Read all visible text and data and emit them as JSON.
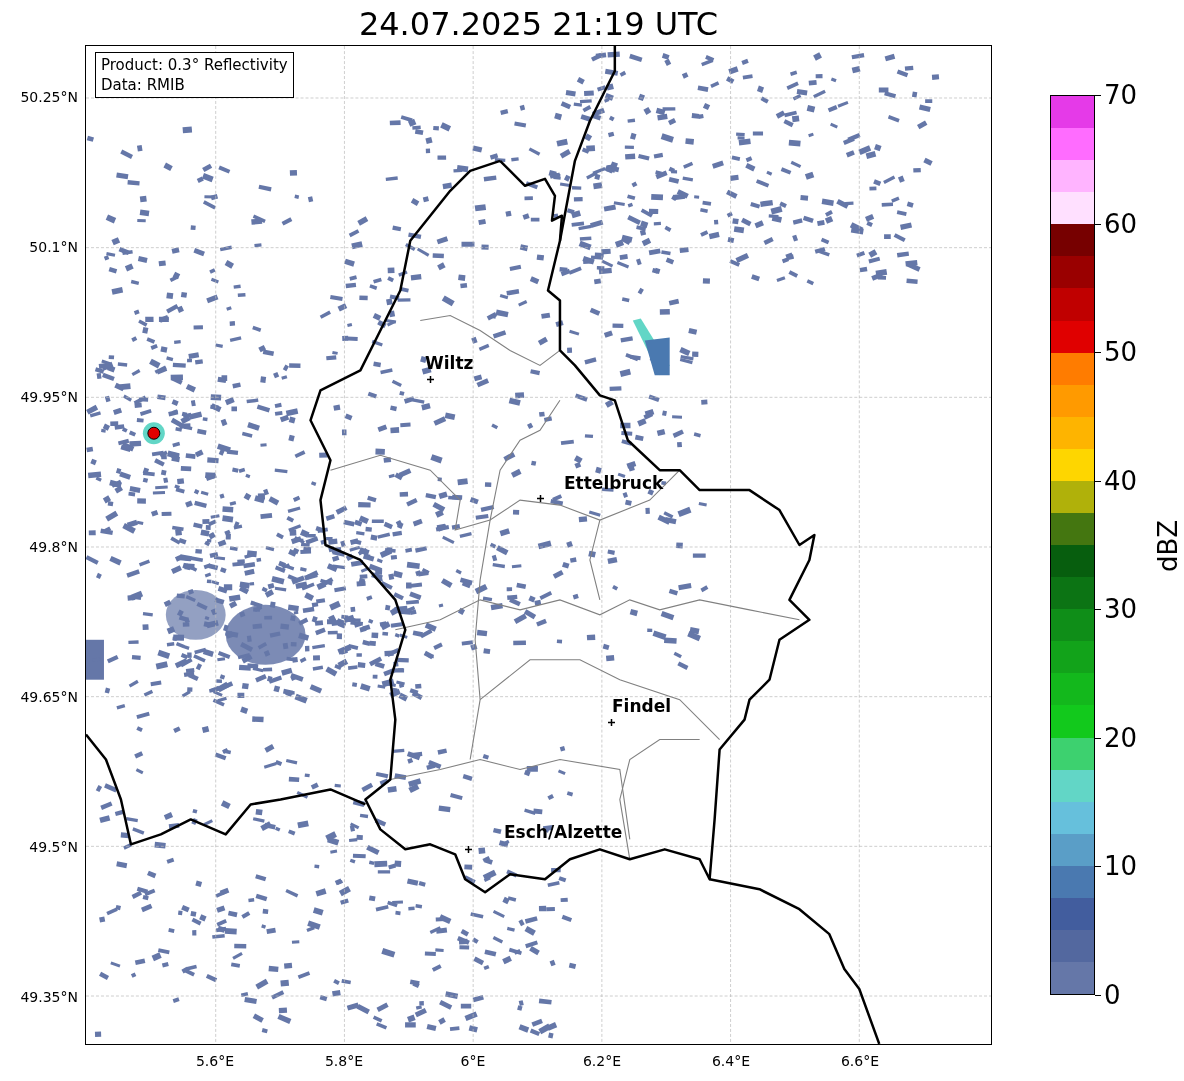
{
  "title": "24.07.2025 21:19 UTC",
  "legend": {
    "lines": [
      "Product: 0.3° Reflectivity",
      "Data: RMIB"
    ]
  },
  "map": {
    "kind": "map-picture"
  },
  "cities": [
    {
      "name": "Wiltz"
    },
    {
      "name": "Ettelbruck"
    },
    {
      "name": "Findel"
    },
    {
      "name": "Esch/Alzette"
    }
  ],
  "y_ticks": [
    "50.25°N",
    "50.1°N",
    "49.95°N",
    "49.8°N",
    "49.65°N",
    "49.5°N",
    "49.35°N"
  ],
  "x_ticks": [
    "5.6°E",
    "5.8°E",
    "6°E",
    "6.2°E",
    "6.4°E",
    "6.6°E"
  ],
  "colorbar": {
    "label": "dBZ",
    "ticks": [
      "70",
      "60",
      "50",
      "40",
      "30",
      "20",
      "10",
      "0"
    ],
    "segments": [
      {
        "color": "#e53ae8"
      },
      {
        "color": "#ff6cff"
      },
      {
        "color": "#ffb4ff"
      },
      {
        "color": "#ffe0ff"
      },
      {
        "color": "#770000"
      },
      {
        "color": "#9a0000"
      },
      {
        "color": "#c00000"
      },
      {
        "color": "#e00000"
      },
      {
        "color": "#ff7c00"
      },
      {
        "color": "#ff9a00"
      },
      {
        "color": "#feb400"
      },
      {
        "color": "#fed600"
      },
      {
        "color": "#b0b10a"
      },
      {
        "color": "#447610"
      },
      {
        "color": "#075e0e"
      },
      {
        "color": "#0c7414"
      },
      {
        "color": "#0f8e18"
      },
      {
        "color": "#12a31a"
      },
      {
        "color": "#13b81c"
      },
      {
        "color": "#12c91c"
      },
      {
        "color": "#3dd16f"
      },
      {
        "color": "#62d6c6"
      },
      {
        "color": "#66c0dc"
      },
      {
        "color": "#5a9ec7"
      },
      {
        "color": "#4a79b0"
      },
      {
        "color": "#425d9e"
      },
      {
        "color": "#53689f"
      },
      {
        "color": "#6577a8"
      }
    ]
  }
}
